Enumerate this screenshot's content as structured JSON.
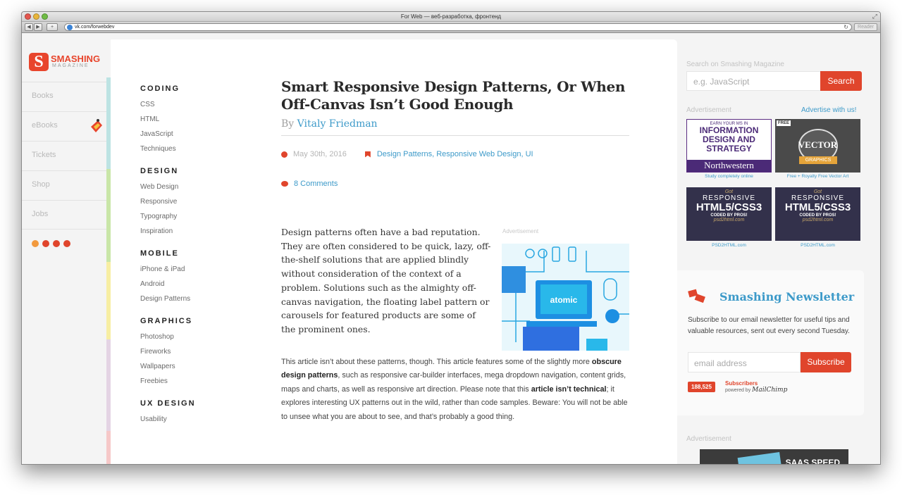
{
  "window": {
    "title": "For Web — веб-разработка, фронтенд",
    "url": "vk.com/forwebdev",
    "reader": "Reader"
  },
  "logo": {
    "name": "SMASHING",
    "sub": "MAGAZINE"
  },
  "nav": [
    "Books",
    "eBooks",
    "Tickets",
    "Shop",
    "Jobs"
  ],
  "categories": [
    {
      "head": "CODING",
      "links": [
        "CSS",
        "HTML",
        "JavaScript",
        "Techniques"
      ]
    },
    {
      "head": "DESIGN",
      "links": [
        "Web Design",
        "Responsive",
        "Typography",
        "Inspiration"
      ]
    },
    {
      "head": "MOBILE",
      "links": [
        "iPhone & iPad",
        "Android",
        "Design Patterns"
      ]
    },
    {
      "head": "GRAPHICS",
      "links": [
        "Photoshop",
        "Fireworks",
        "Wallpapers",
        "Freebies"
      ]
    },
    {
      "head": "UX DESIGN",
      "links": [
        "Usability"
      ]
    }
  ],
  "article": {
    "title": "Smart Responsive Design Patterns, Or When Off-Canvas Isn’t Good Enough",
    "by": "By",
    "author": "Vitaly Friedman",
    "date": "May 30th, 2016",
    "tags": "Design Patterns, Responsive Web Design, UI",
    "comments": "8 Comments",
    "intro": "Design patterns often have a bad reputation. They are often considered to be quick, lazy, off-the-shelf solutions that are applied blindly without consideration of the context of a problem. Solutions such as the almighty off-canvas navigation, the floating label pattern or carousels for featured products are some of the prominent ones.",
    "ad_label": "Advertisement",
    "ad_word": "atomic",
    "body": {
      "p1": "This article isn’t about these patterns, though. This article features some of the slightly more ",
      "b1": "obscure design patterns",
      "p2": ", such as responsive car-builder interfaces, mega dropdown navigation, content grids, maps and charts, as well as responsive art direction. Please note that this ",
      "b2": "article isn’t technical",
      "p3": "; it explores interesting UX patterns out in the wild, rather than code samples. Beware: You will not be able to unsee what you are about to see, and that’s probably a good thing."
    }
  },
  "sidebar": {
    "search_label": "Search on Smashing Magazine",
    "search_placeholder": "e.g. JavaScript",
    "search_button": "Search",
    "ad_label": "Advertisement",
    "advertise": "Advertise with us!",
    "ads": [
      {
        "lines": [
          "EARN YOUR MS IN",
          "INFORMATION",
          "DESIGN AND",
          "STRATEGY",
          "Northwestern"
        ],
        "caption": "Study completely online"
      },
      {
        "lines": [
          "FREE",
          "VECTOR",
          "GRAPHICS"
        ],
        "caption": "Free + Royalty Free Vector Art"
      },
      {
        "lines": [
          "Got",
          "RESPONSIVE",
          "HTML5/CSS3",
          "CODED BY PROS!",
          "psd2html.com"
        ],
        "caption": "PSD2HTML.com"
      },
      {
        "lines": [
          "Got",
          "RESPONSIVE",
          "HTML5/CSS3",
          "CODED BY PROS!",
          "psd2html.com"
        ],
        "caption": "PSD2HTML.com"
      }
    ],
    "newsletter": {
      "title": "Smashing Newsletter",
      "text": "Subscribe to our email newsletter for useful tips and valuable resources, sent out every second Tuesday.",
      "placeholder": "email address",
      "button": "Subscribe",
      "count": "188,525",
      "subs_label": "Subscribers",
      "powered": "powered by",
      "mailchimp": "MailChimp"
    },
    "bottom_ad_label": "Advertisement",
    "bottom_ad_text": "SAAS SPEED"
  },
  "colors": {
    "accent": "#e0452c",
    "link": "#3d9ac9"
  }
}
